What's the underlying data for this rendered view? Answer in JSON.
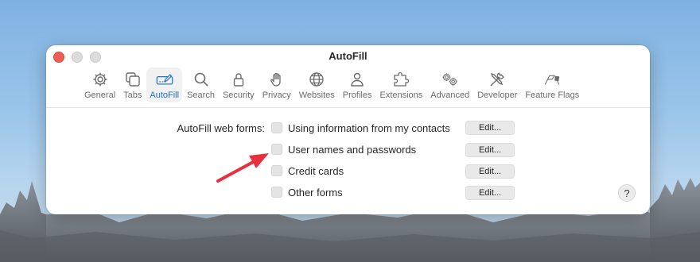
{
  "window": {
    "title": "AutoFill"
  },
  "toolbar": {
    "tabs": [
      {
        "label": "General",
        "icon": "gear-icon"
      },
      {
        "label": "Tabs",
        "icon": "tabs-icon"
      },
      {
        "label": "AutoFill",
        "icon": "pencil-field-icon",
        "active": true
      },
      {
        "label": "Search",
        "icon": "magnifier-icon"
      },
      {
        "label": "Security",
        "icon": "lock-icon"
      },
      {
        "label": "Privacy",
        "icon": "hand-icon"
      },
      {
        "label": "Websites",
        "icon": "globe-icon"
      },
      {
        "label": "Profiles",
        "icon": "person-icon"
      },
      {
        "label": "Extensions",
        "icon": "puzzle-icon"
      },
      {
        "label": "Advanced",
        "icon": "gears-icon"
      },
      {
        "label": "Developer",
        "icon": "tools-icon"
      },
      {
        "label": "Feature Flags",
        "icon": "flags-icon"
      }
    ]
  },
  "autofill": {
    "section_label": "AutoFill web forms:",
    "options": [
      {
        "label": "Using information from my contacts",
        "checked": false,
        "button": "Edit..."
      },
      {
        "label": "User names and passwords",
        "checked": false,
        "button": "Edit..."
      },
      {
        "label": "Credit cards",
        "checked": false,
        "button": "Edit..."
      },
      {
        "label": "Other forms",
        "checked": false,
        "button": "Edit..."
      }
    ]
  },
  "help": {
    "label": "?"
  },
  "colors": {
    "accent": "#1f6fd0",
    "annotation_arrow": "#e8303f",
    "close_button": "#ee5e57"
  }
}
